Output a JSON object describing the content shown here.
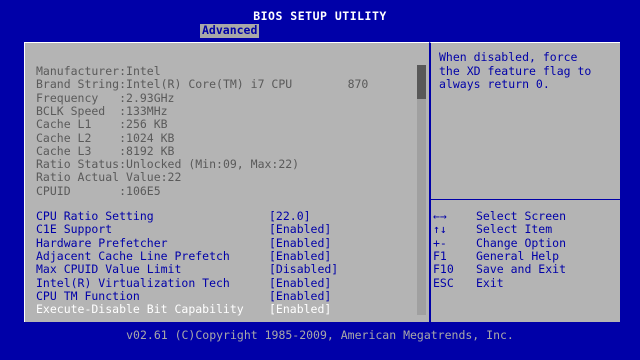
{
  "window": {
    "title": "BIOS SETUP UTILITY",
    "active_tab": "Advanced"
  },
  "info": [
    {
      "label": "Manufacturer",
      "value": ":Intel"
    },
    {
      "label": "Brand String",
      "value": ":Intel(R) Core(TM) i7 CPU        870"
    },
    {
      "label": "Frequency   ",
      "value": ":2.93GHz"
    },
    {
      "label": "BCLK Speed  ",
      "value": ":133MHz"
    },
    {
      "label": "Cache L1    ",
      "value": ":256 KB"
    },
    {
      "label": "Cache L2    ",
      "value": ":1024 KB"
    },
    {
      "label": "Cache L3    ",
      "value": ":8192 KB"
    },
    {
      "label": "Ratio Status",
      "value": ":Unlocked (Min:09, Max:22)"
    },
    {
      "label": "Ratio Actual",
      "value": " Value:22"
    },
    {
      "label": "CPUID       ",
      "value": ":106E5"
    }
  ],
  "settings": [
    {
      "label": "CPU Ratio Setting",
      "value": "[22.0]"
    },
    {
      "label": "C1E Support",
      "value": "[Enabled]"
    },
    {
      "label": "Hardware Prefetcher",
      "value": "[Enabled]"
    },
    {
      "label": "Adjacent Cache Line Prefetch",
      "value": "[Enabled]"
    },
    {
      "label": "Max CPUID Value Limit",
      "value": "[Disabled]"
    },
    {
      "label": "Intel(R) Virtualization Tech",
      "value": "[Enabled]"
    },
    {
      "label": "CPU TM Function",
      "value": "[Enabled]"
    },
    {
      "label": "Execute-Disable Bit Capability",
      "value": "[Enabled]"
    }
  ],
  "help_text": "When disabled, force\nthe XD feature flag to\nalways return 0.",
  "keys": [
    {
      "key": "←→",
      "desc": "Select Screen"
    },
    {
      "key": "↑↓",
      "desc": "Select Item"
    },
    {
      "key": "+-",
      "desc": "Change Option"
    },
    {
      "key": "F1",
      "desc": "General Help"
    },
    {
      "key": "F10",
      "desc": "Save and Exit"
    },
    {
      "key": "ESC",
      "desc": "Exit"
    }
  ],
  "footer": "v02.61 (C)Copyright 1985-2009, American Megatrends, Inc.",
  "colors": {
    "background": "#0000a8",
    "panel": "#b4b4b4",
    "text_blue": "#0000a8",
    "text_gray": "#5a5a5a",
    "highlight": "#ffffff"
  }
}
